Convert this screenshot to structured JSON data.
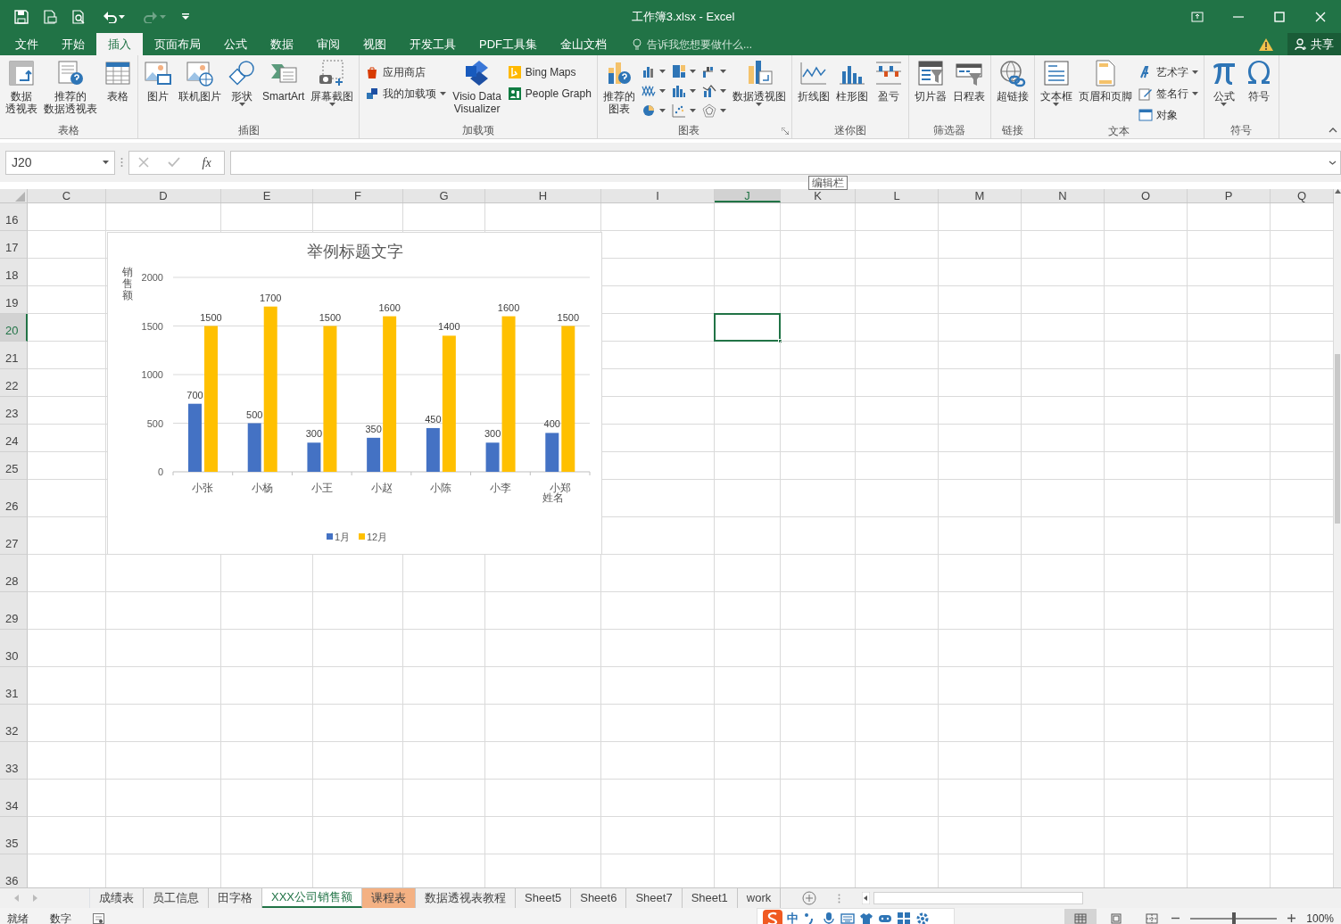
{
  "window": {
    "title": "工作簿3.xlsx - Excel"
  },
  "tell_me": {
    "placeholder": "告诉我您想要做什么..."
  },
  "share_button": "共享",
  "tabs": [
    {
      "label": "文件",
      "selected": false
    },
    {
      "label": "开始",
      "selected": false
    },
    {
      "label": "插入",
      "selected": true
    },
    {
      "label": "页面布局",
      "selected": false
    },
    {
      "label": "公式",
      "selected": false
    },
    {
      "label": "数据",
      "selected": false
    },
    {
      "label": "审阅",
      "selected": false
    },
    {
      "label": "视图",
      "selected": false
    },
    {
      "label": "开发工具",
      "selected": false
    },
    {
      "label": "PDF工具集",
      "selected": false
    },
    {
      "label": "金山文档",
      "selected": false
    }
  ],
  "ribbon": {
    "groups": [
      {
        "label": "表格",
        "dialog_launcher": false,
        "items": [
          {
            "kind": "large",
            "lines": [
              "数据",
              "透视表"
            ],
            "dropdown": false
          },
          {
            "kind": "large",
            "lines": [
              "推荐的",
              "数据透视表"
            ],
            "dropdown": false
          },
          {
            "kind": "large",
            "label": "表格",
            "dropdown": false
          }
        ]
      },
      {
        "label": "插图",
        "dialog_launcher": false,
        "items": [
          {
            "kind": "large",
            "label": "图片",
            "dropdown": false
          },
          {
            "kind": "large",
            "label": "联机图片",
            "dropdown": false
          },
          {
            "kind": "large",
            "label": "形状",
            "dropdown": true
          },
          {
            "kind": "large",
            "label": "SmartArt",
            "dropdown": false
          },
          {
            "kind": "large",
            "label": "屏幕截图",
            "dropdown": true
          }
        ]
      },
      {
        "label": "加载项",
        "dialog_launcher": false,
        "items": [
          {
            "kind": "small",
            "label": "应用商店",
            "dropdown": false
          },
          {
            "kind": "small",
            "label": "我的加载项",
            "dropdown": true
          },
          {
            "kind": "large",
            "lines": [
              "Visio Data",
              "Visualizer"
            ],
            "dropdown": false
          },
          {
            "kind": "small",
            "label": "Bing Maps",
            "dropdown": false
          },
          {
            "kind": "small",
            "label": "People Graph",
            "dropdown": false
          }
        ]
      },
      {
        "label": "图表",
        "dialog_launcher": true,
        "items": [
          {
            "kind": "large",
            "lines": [
              "推荐的",
              "图表"
            ],
            "dropdown": false
          },
          {
            "kind": "icon",
            "dropdown": true
          },
          {
            "kind": "icon",
            "dropdown": true
          },
          {
            "kind": "icon",
            "dropdown": true
          },
          {
            "kind": "icon",
            "dropdown": true
          },
          {
            "kind": "icon",
            "dropdown": true
          },
          {
            "kind": "icon",
            "dropdown": true
          },
          {
            "kind": "icon",
            "dropdown": true
          },
          {
            "kind": "icon",
            "dropdown": true
          },
          {
            "kind": "icon",
            "dropdown": true
          },
          {
            "kind": "large",
            "label": "数据透视图",
            "dropdown": true
          }
        ]
      },
      {
        "label": "迷你图",
        "dialog_launcher": false,
        "items": [
          {
            "kind": "large",
            "label": "折线图",
            "dropdown": false
          },
          {
            "kind": "large",
            "label": "柱形图",
            "dropdown": false
          },
          {
            "kind": "large",
            "label": "盈亏",
            "dropdown": false
          }
        ]
      },
      {
        "label": "筛选器",
        "dialog_launcher": false,
        "items": [
          {
            "kind": "large",
            "label": "切片器",
            "dropdown": false
          },
          {
            "kind": "large",
            "label": "日程表",
            "dropdown": false
          }
        ]
      },
      {
        "label": "链接",
        "dialog_launcher": false,
        "items": [
          {
            "kind": "large",
            "label": "超链接",
            "dropdown": false
          }
        ]
      },
      {
        "label": "文本",
        "dialog_launcher": false,
        "items": [
          {
            "kind": "large",
            "label": "文本框",
            "dropdown": true
          },
          {
            "kind": "large",
            "label": "页眉和页脚",
            "dropdown": false
          },
          {
            "kind": "small",
            "label": "艺术字",
            "dropdown": true
          },
          {
            "kind": "small",
            "label": "签名行",
            "dropdown": true
          },
          {
            "kind": "small",
            "label": "对象",
            "dropdown": false
          }
        ]
      },
      {
        "label": "符号",
        "dialog_launcher": false,
        "items": [
          {
            "kind": "large",
            "label": "公式",
            "dropdown": true
          },
          {
            "kind": "large",
            "label": "符号",
            "dropdown": false
          }
        ]
      }
    ]
  },
  "formula_bar": {
    "name_box": "J20",
    "function_button": "fx"
  },
  "tooltip": "编辑栏",
  "columns": [
    {
      "label": "C",
      "selected": false
    },
    {
      "label": "D",
      "selected": false
    },
    {
      "label": "E",
      "selected": false
    },
    {
      "label": "F",
      "selected": false
    },
    {
      "label": "G",
      "selected": false
    },
    {
      "label": "H",
      "selected": false
    },
    {
      "label": "I",
      "selected": false
    },
    {
      "label": "J",
      "selected": true
    },
    {
      "label": "K",
      "selected": false
    },
    {
      "label": "L",
      "selected": false
    },
    {
      "label": "M",
      "selected": false
    },
    {
      "label": "N",
      "selected": false
    },
    {
      "label": "O",
      "selected": false
    },
    {
      "label": "P",
      "selected": false
    },
    {
      "label": "Q",
      "selected": false
    }
  ],
  "rows": [
    {
      "label": "16",
      "selected": false
    },
    {
      "label": "17",
      "selected": false
    },
    {
      "label": "18",
      "selected": false
    },
    {
      "label": "19",
      "selected": false
    },
    {
      "label": "20",
      "selected": true
    },
    {
      "label": "21",
      "selected": false
    },
    {
      "label": "22",
      "selected": false
    },
    {
      "label": "23",
      "selected": false
    },
    {
      "label": "24",
      "selected": false
    },
    {
      "label": "25",
      "selected": false
    },
    {
      "label": "26",
      "selected": false
    },
    {
      "label": "27",
      "selected": false
    },
    {
      "label": "28",
      "selected": false
    },
    {
      "label": "29",
      "selected": false
    },
    {
      "label": "30",
      "selected": false
    },
    {
      "label": "31",
      "selected": false
    },
    {
      "label": "32",
      "selected": false
    },
    {
      "label": "33",
      "selected": false
    },
    {
      "label": "34",
      "selected": false
    },
    {
      "label": "35",
      "selected": false
    },
    {
      "label": "36",
      "selected": false
    }
  ],
  "chart": {
    "chart_data": {
      "type": "bar",
      "title": "举例标题文字",
      "xlabel": "姓名",
      "ylabel": "销售额",
      "categories": [
        "小张",
        "小杨",
        "小王",
        "小赵",
        "小陈",
        "小李",
        "小郑"
      ],
      "series": [
        {
          "name": "1月",
          "color": "#4472c4",
          "values": [
            700,
            500,
            300,
            350,
            450,
            300,
            400
          ]
        },
        {
          "name": "12月",
          "color": "#ffc000",
          "values": [
            1500,
            1700,
            1500,
            1600,
            1400,
            1600,
            1500
          ]
        }
      ],
      "ylim": [
        0,
        2000
      ],
      "yticks": [
        0,
        500,
        1000,
        1500,
        2000
      ],
      "data_labels": true,
      "grid": true,
      "legend": "bottom"
    }
  },
  "sheet_tabs": [
    {
      "label": "成绩表",
      "selected": false
    },
    {
      "label": "员工信息",
      "selected": false
    },
    {
      "label": "田字格",
      "selected": false
    },
    {
      "label": "XXX公司销售额",
      "selected": true
    },
    {
      "label": "课程表",
      "selected": false,
      "color": "#f4b183"
    },
    {
      "label": "数据透视表教程",
      "selected": false
    },
    {
      "label": "Sheet5",
      "selected": false
    },
    {
      "label": "Sheet6",
      "selected": false
    },
    {
      "label": "Sheet7",
      "selected": false
    },
    {
      "label": "Sheet1",
      "selected": false
    },
    {
      "label": "work",
      "selected": false
    }
  ],
  "status_bar": {
    "items": [
      "就绪",
      "数字"
    ],
    "ime_label": "中",
    "views": [
      {
        "selected": true
      },
      {
        "selected": false
      },
      {
        "selected": false
      }
    ],
    "zoom_slider": {
      "level": 0.5
    },
    "zoom": "100%"
  }
}
